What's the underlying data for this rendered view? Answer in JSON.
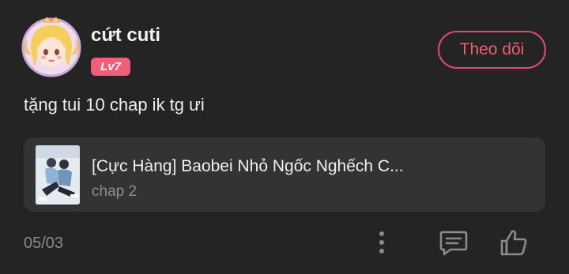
{
  "user": {
    "name": "cứt cuti",
    "level": "Lv7",
    "avatar_icon": "princess-avatar-icon"
  },
  "follow_label": "Theo dõi",
  "post": {
    "text": "tặng tui 10 chap ik tg ưi",
    "date": "05/03"
  },
  "manga_card": {
    "title": "[Cực Hàng] Baobei Nhỏ Ngốc Nghếch C...",
    "chapter": "chap 2",
    "thumbnail_icon": "manga-cover-icon"
  },
  "actions": {
    "more_icon": "more-vertical-icon",
    "comment_icon": "comment-icon",
    "like_icon": "thumbs-up-icon"
  },
  "colors": {
    "background": "#242424",
    "card": "#333333",
    "accent": "#e04d6a",
    "badge": "#f25d7a"
  }
}
